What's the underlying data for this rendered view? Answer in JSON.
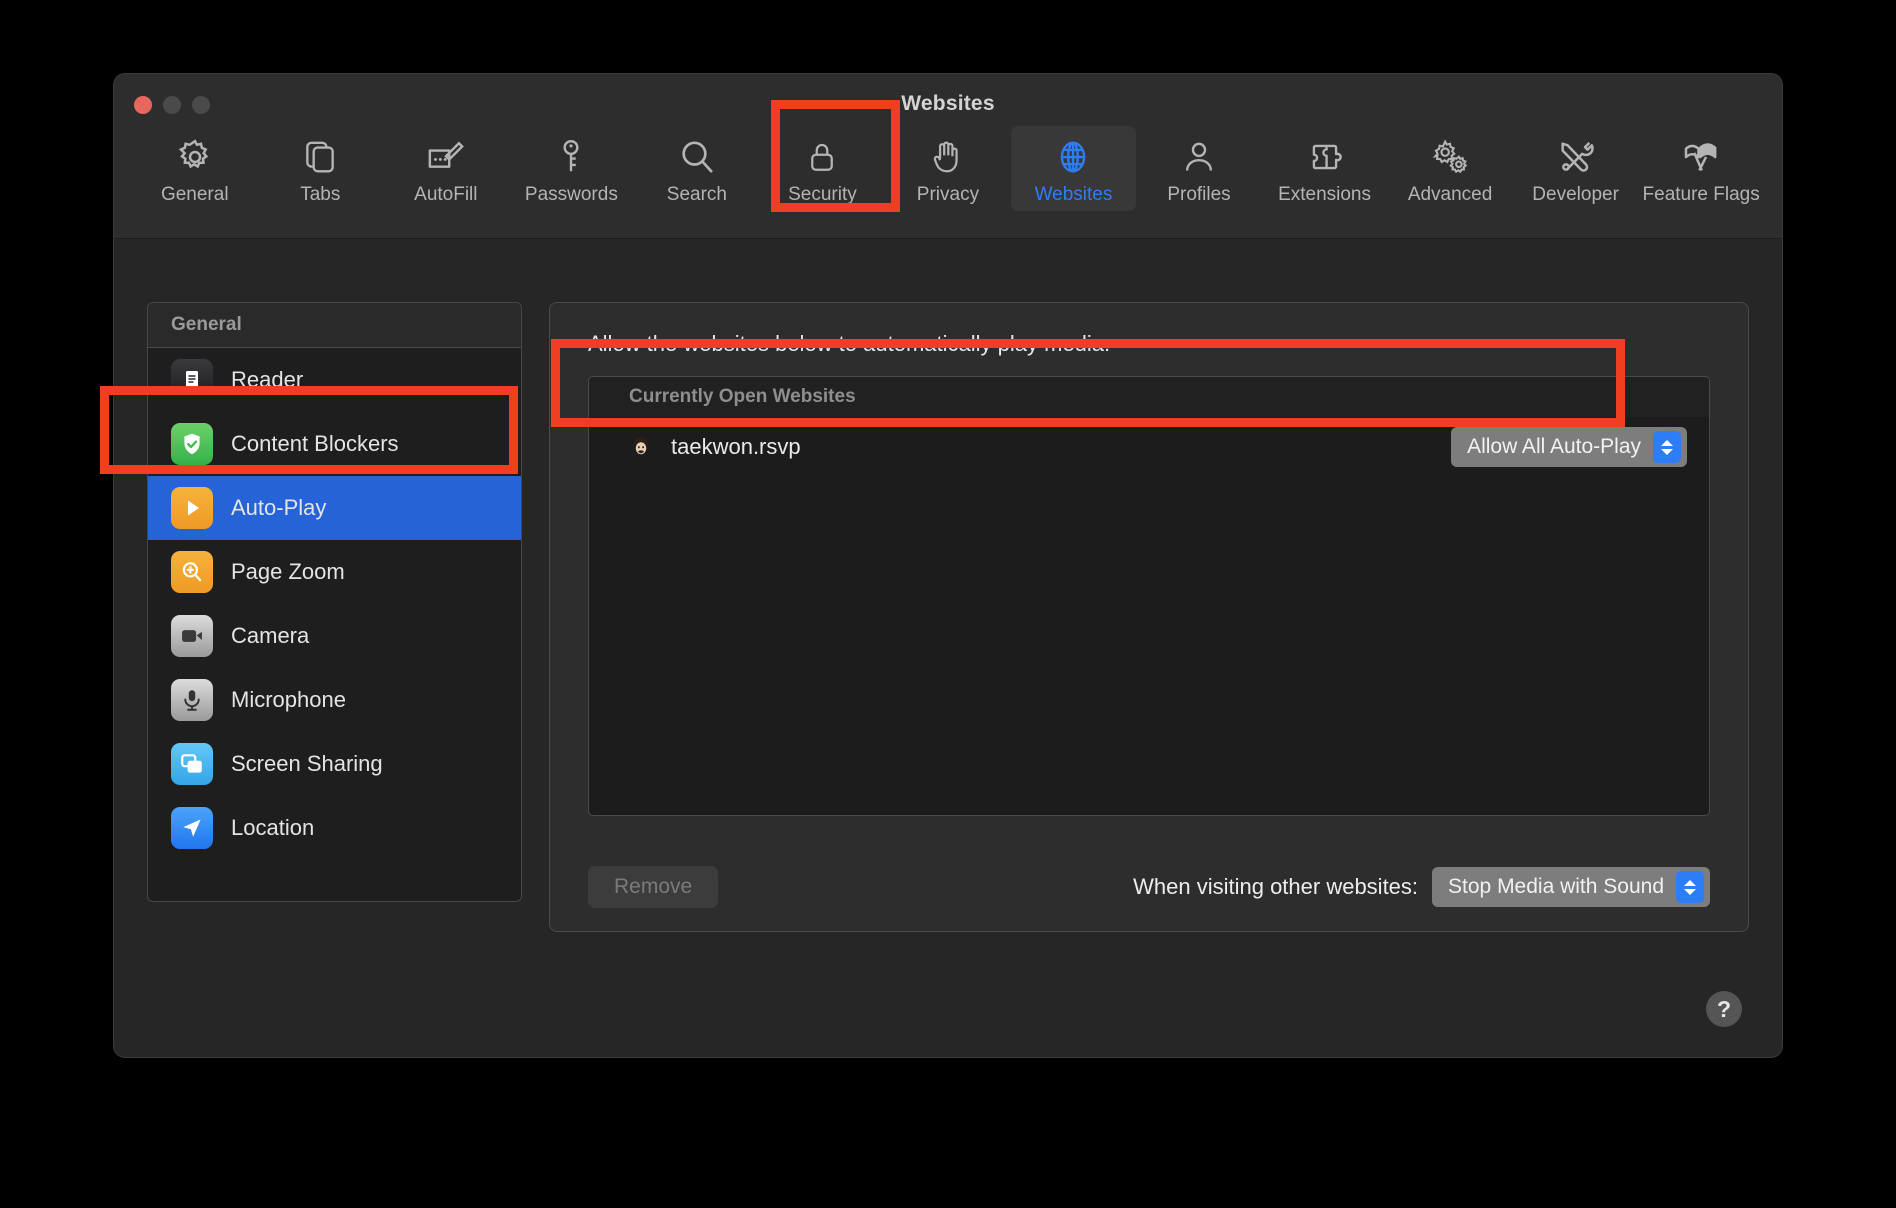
{
  "window": {
    "title": "Websites",
    "traffic_lights": [
      "close-button",
      "minimize-button",
      "maximize-button"
    ]
  },
  "toolbar": {
    "items": [
      {
        "label": "General",
        "icon": "gear-icon",
        "selected": false
      },
      {
        "label": "Tabs",
        "icon": "tabs-icon",
        "selected": false
      },
      {
        "label": "AutoFill",
        "icon": "autofill-icon",
        "selected": false
      },
      {
        "label": "Passwords",
        "icon": "key-icon",
        "selected": false
      },
      {
        "label": "Search",
        "icon": "search-icon",
        "selected": false
      },
      {
        "label": "Security",
        "icon": "lock-icon",
        "selected": false
      },
      {
        "label": "Privacy",
        "icon": "hand-icon",
        "selected": false
      },
      {
        "label": "Websites",
        "icon": "globe-icon",
        "selected": true
      },
      {
        "label": "Profiles",
        "icon": "person-icon",
        "selected": false
      },
      {
        "label": "Extensions",
        "icon": "puzzle-icon",
        "selected": false
      },
      {
        "label": "Advanced",
        "icon": "gears-icon",
        "selected": false
      },
      {
        "label": "Developer",
        "icon": "tools-icon",
        "selected": false
      },
      {
        "label": "Feature Flags",
        "icon": "flags-icon",
        "selected": false
      }
    ]
  },
  "sidebar": {
    "header": "General",
    "items": [
      {
        "label": "Reader",
        "icon": "reader-icon",
        "active": false
      },
      {
        "label": "Content Blockers",
        "icon": "shield-check-icon",
        "active": false
      },
      {
        "label": "Auto-Play",
        "icon": "play-icon",
        "active": true
      },
      {
        "label": "Page Zoom",
        "icon": "magnifier-plus-icon",
        "active": false
      },
      {
        "label": "Camera",
        "icon": "camera-icon",
        "active": false
      },
      {
        "label": "Microphone",
        "icon": "microphone-icon",
        "active": false
      },
      {
        "label": "Screen Sharing",
        "icon": "screen-sharing-icon",
        "active": false
      },
      {
        "label": "Location",
        "icon": "location-arrow-icon",
        "active": false
      }
    ]
  },
  "main": {
    "heading": "Allow the websites below to automatically play media:",
    "list_group_header": "Currently Open Websites",
    "rows": [
      {
        "site": "taekwon.rsvp",
        "favicon": "avatar-favicon",
        "setting": "Allow All Auto-Play"
      }
    ],
    "remove_button": "Remove",
    "other_websites_label": "When visiting other websites:",
    "other_websites_value": "Stop Media with Sound",
    "help_button": "?"
  },
  "colors": {
    "accent_blue": "#2d7df6",
    "selection_blue": "#2563d6",
    "annotation_red": "#f03f20",
    "window_bg": "#2a2a2a",
    "panel_bg": "#2d2d2d",
    "list_bg": "#1c1c1c"
  },
  "annotations": [
    {
      "name": "websites-tab-highlight"
    },
    {
      "name": "auto-play-sidebar-highlight"
    },
    {
      "name": "website-row-highlight"
    }
  ]
}
